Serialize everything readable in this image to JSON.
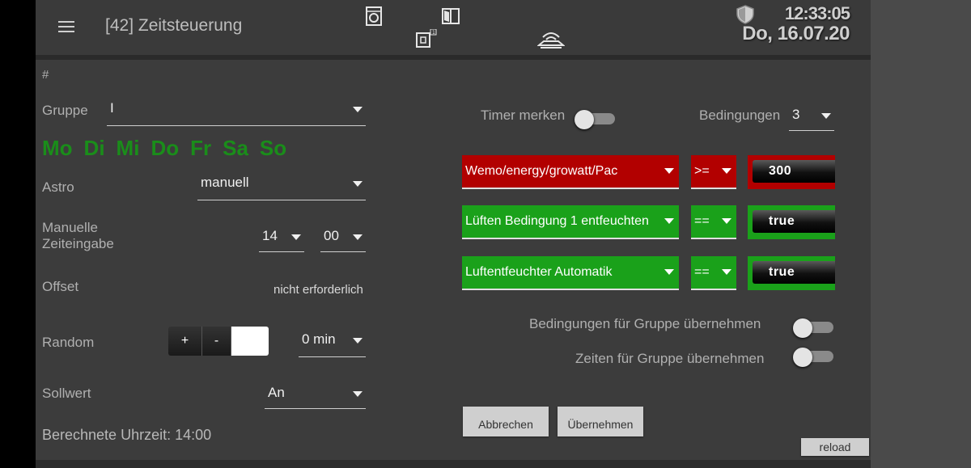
{
  "header": {
    "title": "[42] Zeitsteuerung",
    "time": "12:33:05",
    "date": "Do, 16.07.20",
    "icons": [
      "washing-machine-icon",
      "door-icon",
      "dryer-icon",
      "network-router-icon",
      "shield-icon"
    ]
  },
  "left": {
    "hash": "#",
    "gruppe_label": "Gruppe",
    "gruppe_value": "I",
    "days": [
      "Mo",
      "Di",
      "Mi",
      "Do",
      "Fr",
      "Sa",
      "So"
    ],
    "days_color": "#1a8d1a",
    "astro_label": "Astro",
    "astro_value": "manuell",
    "manual_label_line1": "Manuelle",
    "manual_label_line2": "Zeiteingabe",
    "hour": "14",
    "minute": "00",
    "offset_label": "Offset",
    "offset_value": "nicht erforderlich",
    "random_label": "Random",
    "random_plus": "+",
    "random_minus": "-",
    "random_value": "0 min",
    "sollwert_label": "Sollwert",
    "sollwert_value": "An",
    "computed": "Berechnete Uhrzeit: 14:00"
  },
  "right": {
    "timer_label": "Timer merken",
    "timer_on": false,
    "bedingungen_label": "Bedingungen",
    "bedingungen_value": "3",
    "conditions": [
      {
        "source": "Wemo/energy/growatt/Pac",
        "op": ">=",
        "value": "300",
        "status": "red"
      },
      {
        "source": "Lüften Bedingung 1 entfeuchten",
        "op": "==",
        "value": "true",
        "status": "green"
      },
      {
        "source": "Luftentfeuchter Automatik",
        "op": "==",
        "value": "true",
        "status": "green"
      }
    ],
    "group_conditions_label": "Bedingungen für Gruppe übernehmen",
    "group_times_label": "Zeiten für Gruppe übernehmen",
    "cancel_label": "Abbrechen",
    "apply_label": "Übernehmen",
    "reload_label": "reload"
  },
  "colors": {
    "red": "#b20000",
    "green": "#1aa11a",
    "background": "#3c3c3c"
  }
}
